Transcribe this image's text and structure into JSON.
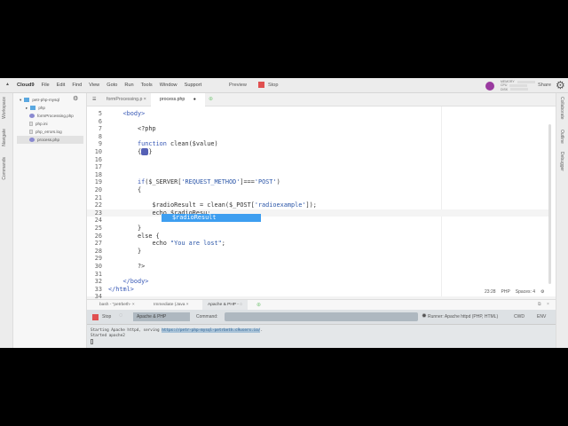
{
  "menubar": {
    "brand": "Cloud9",
    "items": [
      "File",
      "Edit",
      "Find",
      "View",
      "Goto",
      "Run",
      "Tools",
      "Window",
      "Support"
    ],
    "preview": "Preview",
    "stop": "Stop",
    "meters": [
      "MEMORY",
      "CPU",
      "DISK"
    ],
    "share": "Share"
  },
  "left_tabs": [
    "Workspace",
    "Navigate",
    "Commands"
  ],
  "right_tabs": [
    "Collaborate",
    "Outline",
    "Debugger"
  ],
  "tree": {
    "root": "petr-php-mysql",
    "items": [
      "php",
      "formProcessing.php",
      "php.ini",
      "php_errors.log",
      "process.php"
    ]
  },
  "tabs": [
    "formProcessing.p ×",
    "process.php"
  ],
  "code": [
    {
      "n": "5",
      "s": [
        [
          "tg",
          "    <body>"
        ]
      ]
    },
    {
      "n": "6",
      "s": []
    },
    {
      "n": "7",
      "s": [
        [
          "vr",
          "        <?php"
        ]
      ]
    },
    {
      "n": "8",
      "s": []
    },
    {
      "n": "9",
      "s": [
        [
          "kw",
          "        function "
        ],
        [
          "vr",
          "clean($value)"
        ]
      ]
    },
    {
      "n": "10",
      "s": [
        [
          "vr",
          "        {"
        ],
        [
          "fold-mark",
          "↔↔"
        ],
        [
          "vr",
          "}"
        ]
      ]
    },
    {
      "n": "16",
      "s": []
    },
    {
      "n": "17",
      "s": []
    },
    {
      "n": "18",
      "s": []
    },
    {
      "n": "19",
      "s": [
        [
          "kw",
          "        if"
        ],
        [
          "vr",
          "($_SERVER["
        ],
        [
          "st",
          "'REQUEST_METHOD'"
        ],
        [
          "vr",
          "]==="
        ],
        [
          "st",
          "'POST'"
        ],
        [
          "vr",
          ")"
        ]
      ]
    },
    {
      "n": "20",
      "s": [
        [
          "vr",
          "        {"
        ]
      ]
    },
    {
      "n": "21",
      "s": []
    },
    {
      "n": "22",
      "s": [
        [
          "vr",
          "            $radioResult = clean($_POST["
        ],
        [
          "st",
          "'radioexample'"
        ],
        [
          "vr",
          "]);"
        ]
      ]
    },
    {
      "n": "23",
      "s": [
        [
          "vr",
          "            echo $radioResu;"
        ]
      ],
      "current": true
    },
    {
      "n": "24",
      "s": []
    },
    {
      "n": "25",
      "s": [
        [
          "vr",
          "        }"
        ]
      ]
    },
    {
      "n": "26",
      "s": [
        [
          "vr",
          "        else {"
        ]
      ]
    },
    {
      "n": "27",
      "s": [
        [
          "vr",
          "            echo "
        ],
        [
          "st",
          "\"You are lost\""
        ],
        [
          "vr",
          ";"
        ]
      ]
    },
    {
      "n": "28",
      "s": [
        [
          "vr",
          "        }"
        ]
      ]
    },
    {
      "n": "29",
      "s": []
    },
    {
      "n": "30",
      "s": [
        [
          "vr",
          "        ?>"
        ]
      ]
    },
    {
      "n": "31",
      "s": []
    },
    {
      "n": "32",
      "s": [
        [
          "tg",
          "    </body>"
        ]
      ]
    },
    {
      "n": "33",
      "s": [
        [
          "tg",
          "</html>"
        ]
      ]
    },
    {
      "n": "34",
      "s": []
    }
  ],
  "autocomplete": "$radioResult",
  "status": {
    "position": "23:28",
    "mode": "PHP",
    "spaces": "Spaces: 4"
  },
  "panel": {
    "tabs": [
      "bash - \"petrbeth- ×",
      "Immediate (Java ×",
      "Apache & PHP -"
    ],
    "stop": "Stop",
    "runner_name": "Apache & PHP",
    "command_label": "Command:",
    "runner": "Runner: Apache httpd (PHP, HTML)",
    "cwd": "CWD",
    "env": "ENV",
    "output": {
      "line1_prefix": "Starting Apache httpd, serving ",
      "url": "https://petr-php-mysql-petrbeth.c9users.io/",
      "line1_suffix": ".",
      "line2": "Started apache2"
    }
  }
}
